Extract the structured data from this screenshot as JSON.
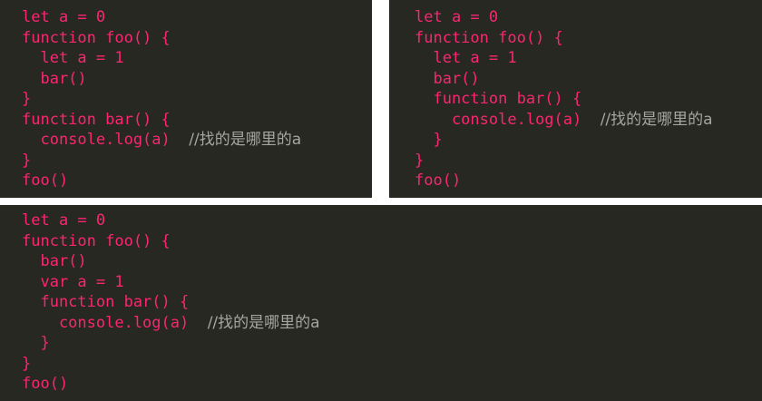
{
  "panels": [
    {
      "lines": [
        {
          "code": "let a = 0",
          "comment": ""
        },
        {
          "code": "function foo() {",
          "comment": ""
        },
        {
          "code": "  let a = 1",
          "comment": ""
        },
        {
          "code": "  bar()",
          "comment": ""
        },
        {
          "code": "}",
          "comment": ""
        },
        {
          "code": "function bar() {",
          "comment": ""
        },
        {
          "code": "  console.log(a)  ",
          "comment": "//找的是哪里的a"
        },
        {
          "code": "}",
          "comment": ""
        },
        {
          "code": "foo()",
          "comment": ""
        }
      ]
    },
    {
      "lines": [
        {
          "code": "let a = 0",
          "comment": ""
        },
        {
          "code": "function foo() {",
          "comment": ""
        },
        {
          "code": "  let a = 1",
          "comment": ""
        },
        {
          "code": "  bar()",
          "comment": ""
        },
        {
          "code": "  function bar() {",
          "comment": ""
        },
        {
          "code": "    console.log(a)  ",
          "comment": "//找的是哪里的a"
        },
        {
          "code": "  }",
          "comment": ""
        },
        {
          "code": "}",
          "comment": ""
        },
        {
          "code": "foo()",
          "comment": ""
        }
      ]
    },
    {
      "lines": [
        {
          "code": "let a = 0",
          "comment": ""
        },
        {
          "code": "function foo() {",
          "comment": ""
        },
        {
          "code": "  bar()",
          "comment": ""
        },
        {
          "code": "  var a = 1",
          "comment": ""
        },
        {
          "code": "  function bar() {",
          "comment": ""
        },
        {
          "code": "    console.log(a)  ",
          "comment": "//找的是哪里的a"
        },
        {
          "code": "  }",
          "comment": ""
        },
        {
          "code": "}",
          "comment": ""
        },
        {
          "code": "foo()",
          "comment": ""
        }
      ]
    }
  ],
  "colors": {
    "background": "#272822",
    "keyword": "#f92672",
    "comment": "#a6a69f",
    "page": "#ffffff"
  }
}
